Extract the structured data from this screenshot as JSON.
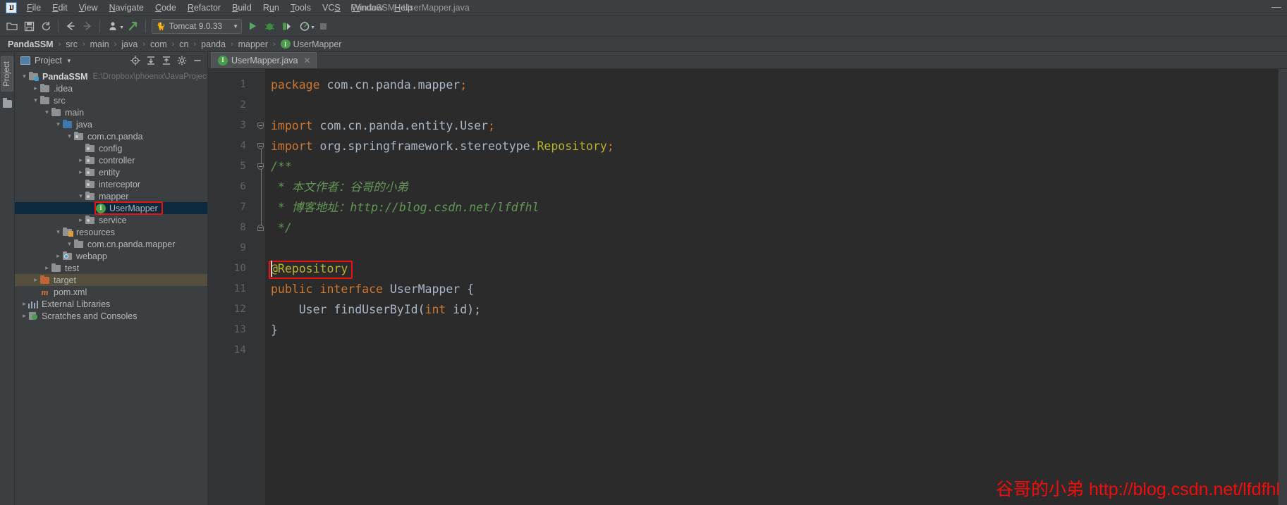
{
  "window": {
    "title": "PandaSSM - UserMapper.java",
    "minimize_label": "—",
    "logo_text": "IJ"
  },
  "menubar": {
    "items": [
      {
        "mnemonic": "F",
        "rest": "ile"
      },
      {
        "mnemonic": "E",
        "rest": "dit"
      },
      {
        "mnemonic": "V",
        "rest": "iew"
      },
      {
        "mnemonic": "N",
        "rest": "avigate"
      },
      {
        "mnemonic": "C",
        "rest": "ode"
      },
      {
        "mnemonic": "R",
        "rest": "efactor"
      },
      {
        "mnemonic": "B",
        "rest": "uild"
      },
      {
        "mnemonic": "R",
        "rest": "un",
        "pre": "R",
        "mid": "u",
        "post": "n"
      },
      {
        "mnemonic": "T",
        "rest": "ools"
      },
      {
        "mnemonic": "S",
        "rest": "VCS"
      },
      {
        "mnemonic": "W",
        "rest": "indow"
      },
      {
        "mnemonic": "H",
        "rest": "elp"
      }
    ],
    "labels": [
      "File",
      "Edit",
      "View",
      "Navigate",
      "Code",
      "Refactor",
      "Build",
      "Run",
      "Tools",
      "VCS",
      "Window",
      "Help"
    ]
  },
  "toolbar": {
    "open_icon": "open-folder-icon",
    "save_icon": "save-icon",
    "sync_icon": "sync-icon",
    "back_icon": "back-arrow-icon",
    "forward_icon": "forward-arrow-icon",
    "profile_icon": "profile-icon",
    "update_icon": "vcs-update-icon",
    "run_config_label": "Tomcat 9.0.33",
    "run_config_icon": "tomcat-icon",
    "run_icon": "run-icon",
    "debug_icon": "debug-icon",
    "coverage_icon": "run-coverage-icon",
    "profiler_icon": "profiler-icon",
    "stop_icon": "stop-icon"
  },
  "breadcrumb": {
    "items": [
      "PandaSSM",
      "src",
      "main",
      "java",
      "com",
      "cn",
      "panda",
      "mapper",
      "UserMapper"
    ],
    "last_icon": "interface-icon",
    "separator": "›"
  },
  "stripe": {
    "project_tab": "Project",
    "structure_icon": "structure-icon"
  },
  "project_panel": {
    "title": "Project",
    "dropdown_icon": "chevron-down-icon",
    "tools": [
      "locate-icon",
      "expand-all-icon",
      "collapse-all-icon",
      "gear-icon",
      "hide-icon"
    ],
    "tree": [
      {
        "indent": 0,
        "arrow": "down",
        "icon": "folder-module",
        "label": "PandaSSM",
        "bold": true,
        "hint": "E:\\Dropbox\\phoenix\\JavaProjects\\Pa"
      },
      {
        "indent": 1,
        "arrow": "right",
        "icon": "folder-plain",
        "label": ".idea"
      },
      {
        "indent": 1,
        "arrow": "down",
        "icon": "folder-plain",
        "label": "src"
      },
      {
        "indent": 2,
        "arrow": "down",
        "icon": "folder-plain",
        "label": "main"
      },
      {
        "indent": 3,
        "arrow": "down",
        "icon": "folder-source",
        "label": "java"
      },
      {
        "indent": 4,
        "arrow": "down",
        "icon": "folder-package",
        "label": "com.cn.panda"
      },
      {
        "indent": 5,
        "arrow": "none",
        "icon": "folder-package",
        "label": "config"
      },
      {
        "indent": 5,
        "arrow": "right",
        "icon": "folder-package",
        "label": "controller"
      },
      {
        "indent": 5,
        "arrow": "right",
        "icon": "folder-package",
        "label": "entity"
      },
      {
        "indent": 5,
        "arrow": "none",
        "icon": "folder-package",
        "label": "interceptor"
      },
      {
        "indent": 5,
        "arrow": "down",
        "icon": "folder-package",
        "label": "mapper"
      },
      {
        "indent": 6,
        "arrow": "none",
        "icon": "interface-icon",
        "label": "UserMapper",
        "selected": true,
        "annotated": true
      },
      {
        "indent": 5,
        "arrow": "right",
        "icon": "folder-package",
        "label": "service"
      },
      {
        "indent": 3,
        "arrow": "down",
        "icon": "folder-resources",
        "label": "resources"
      },
      {
        "indent": 4,
        "arrow": "down",
        "icon": "folder-plain",
        "label": "com.cn.panda.mapper"
      },
      {
        "indent": 3,
        "arrow": "right",
        "icon": "folder-web",
        "label": "webapp"
      },
      {
        "indent": 2,
        "arrow": "right",
        "icon": "folder-plain",
        "label": "test"
      },
      {
        "indent": 1,
        "arrow": "right",
        "icon": "folder-excluded",
        "label": "target",
        "target_row": true
      },
      {
        "indent": 1,
        "arrow": "none",
        "icon": "maven-icon",
        "label": "pom.xml"
      },
      {
        "indent": 0,
        "arrow": "right",
        "icon": "library-icon",
        "label": "External Libraries"
      },
      {
        "indent": 0,
        "arrow": "right",
        "icon": "scratch-icon",
        "label": "Scratches and Consoles"
      }
    ]
  },
  "editor": {
    "tab": {
      "label": "UserMapper.java",
      "icon": "interface-icon",
      "close_icon": "close-icon"
    },
    "line_numbers": [
      "1",
      "2",
      "3",
      "4",
      "5",
      "6",
      "7",
      "8",
      "9",
      "10",
      "11",
      "12",
      "13",
      "14"
    ],
    "lines": [
      {
        "n": "1",
        "tokens": [
          {
            "t": "package ",
            "c": "kw"
          },
          {
            "t": "com.cn.panda.mapper",
            "c": "type"
          },
          {
            "t": ";",
            "c": "semi"
          }
        ]
      },
      {
        "n": "2",
        "tokens": []
      },
      {
        "n": "3",
        "tokens": [
          {
            "t": "import ",
            "c": "kw"
          },
          {
            "t": "com.cn.panda.entity.User",
            "c": "type"
          },
          {
            "t": ";",
            "c": "semi"
          }
        ]
      },
      {
        "n": "4",
        "tokens": [
          {
            "t": "import ",
            "c": "kw"
          },
          {
            "t": "org.springframework.stereotype.",
            "c": "type"
          },
          {
            "t": "Repository",
            "c": "anno"
          },
          {
            "t": ";",
            "c": "semi"
          }
        ]
      },
      {
        "n": "5",
        "tokens": [
          {
            "t": "/**",
            "c": "cmt"
          }
        ]
      },
      {
        "n": "6",
        "tokens": [
          {
            "t": " * 本文作者：谷哥的小弟",
            "c": "cmt"
          }
        ]
      },
      {
        "n": "7",
        "tokens": [
          {
            "t": " * 博客地址：http://blog.csdn.net/lfdfhl",
            "c": "cmt"
          }
        ]
      },
      {
        "n": "8",
        "tokens": [
          {
            "t": " */",
            "c": "cmt"
          }
        ]
      },
      {
        "n": "9",
        "tokens": []
      },
      {
        "n": "10",
        "tokens": [
          {
            "t": "@Repository",
            "c": "anno"
          }
        ],
        "annotated": true
      },
      {
        "n": "11",
        "tokens": [
          {
            "t": "public ",
            "c": "kw"
          },
          {
            "t": "interface ",
            "c": "kw"
          },
          {
            "t": "UserMapper",
            "c": "type"
          },
          {
            "t": " {",
            "c": "type"
          }
        ]
      },
      {
        "n": "12",
        "tokens": [
          {
            "t": "    User findUserById(",
            "c": "type"
          },
          {
            "t": "int",
            "c": "kw"
          },
          {
            "t": " id);",
            "c": "type"
          }
        ]
      },
      {
        "n": "13",
        "tokens": [
          {
            "t": "}",
            "c": "type"
          }
        ]
      },
      {
        "n": "14",
        "tokens": []
      }
    ]
  },
  "watermark": {
    "author": "谷哥的小弟",
    "url": "http://blog.csdn.net/lfdfhl",
    "color": "#f20d0d"
  },
  "colors": {
    "background": "#3c3f41",
    "editor_background": "#2b2b2b",
    "gutter_background": "#313335",
    "selection": "#0d293e",
    "annotation_red": "#ee1111",
    "keyword_orange": "#cc7832",
    "comment_green": "#629755",
    "annotation_yellow": "#bbb529",
    "text": "#a9b7c6"
  }
}
